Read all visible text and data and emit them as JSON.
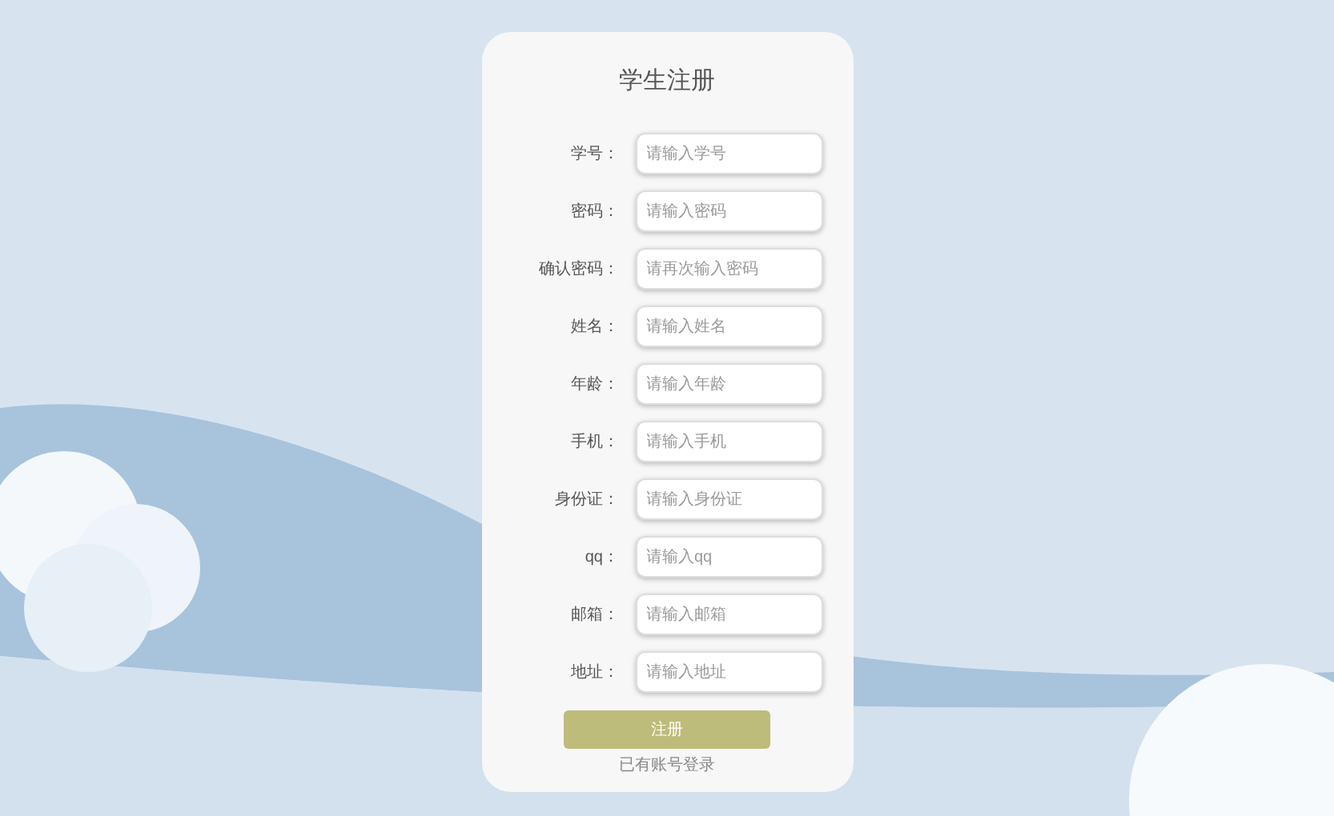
{
  "title": "学生注册",
  "fields": [
    {
      "label": "学号：",
      "placeholder": "请输入学号"
    },
    {
      "label": "密码：",
      "placeholder": "请输入密码"
    },
    {
      "label": "确认密码：",
      "placeholder": "请再次输入密码"
    },
    {
      "label": "姓名：",
      "placeholder": "请输入姓名"
    },
    {
      "label": "年龄：",
      "placeholder": "请输入年龄"
    },
    {
      "label": "手机：",
      "placeholder": "请输入手机"
    },
    {
      "label": "身份证：",
      "placeholder": "请输入身份证"
    },
    {
      "label": "qq：",
      "placeholder": "请输入qq"
    },
    {
      "label": "邮箱：",
      "placeholder": "请输入邮箱"
    },
    {
      "label": "地址：",
      "placeholder": "请输入地址"
    }
  ],
  "submit_button": "注册",
  "login_link": "已有账号登录"
}
